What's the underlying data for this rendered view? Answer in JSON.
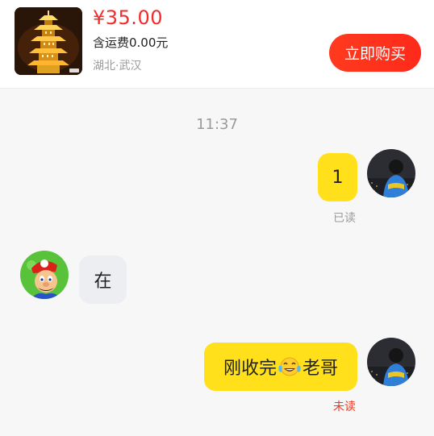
{
  "product": {
    "price": "¥35.00",
    "shipping": "含运费0.00元",
    "location": "湖北·武汉",
    "buy_label": "立即购买",
    "image_icon": "yellow-crane-tower-thumbnail"
  },
  "chat": {
    "timestamp": "11:37",
    "messages": [
      {
        "sender": "me",
        "text": "1",
        "status": "已读"
      },
      {
        "sender": "seller",
        "text": "在"
      },
      {
        "sender": "me",
        "text_before": "刚收完",
        "emoji": "crying-laughing-emoji",
        "text_after": "老哥",
        "status": "未读"
      }
    ]
  },
  "colors": {
    "price": "#f52b2b",
    "buy_button": "#ff3a1f",
    "my_bubble": "#ffe01b",
    "their_bubble": "#eceef2",
    "read_status": "#9a9a9a",
    "unread_status": "#f5351e"
  }
}
